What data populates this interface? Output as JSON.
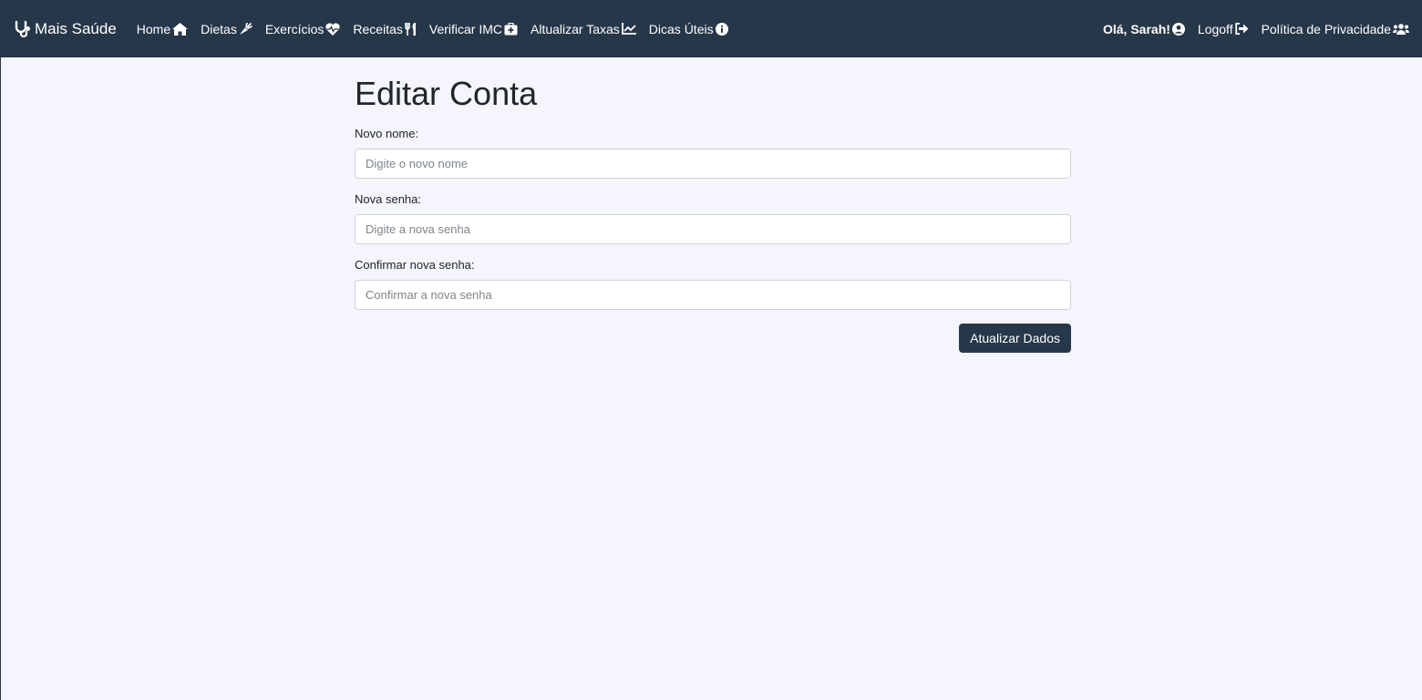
{
  "navbar": {
    "brand": "Mais Saúde",
    "left_items": [
      {
        "label": "Home",
        "icon": "home-icon"
      },
      {
        "label": "Dietas",
        "icon": "carrot-icon"
      },
      {
        "label": "Exercícios",
        "icon": "heartbeat-icon"
      },
      {
        "label": "Receitas",
        "icon": "utensils-icon"
      },
      {
        "label": "Verificar IMC",
        "icon": "medkit-icon"
      },
      {
        "label": "Altualizar Taxas",
        "icon": "chart-line-icon"
      },
      {
        "label": "Dicas Úteis",
        "icon": "info-circle-icon"
      }
    ],
    "right_items": [
      {
        "label": "Olá, Sarah!",
        "icon": "user-circle-icon"
      },
      {
        "label": "Logoff",
        "icon": "sign-out-icon"
      },
      {
        "label": "Política de Privacidade",
        "icon": "users-icon"
      }
    ]
  },
  "form": {
    "title": "Editar Conta",
    "fields": [
      {
        "label": "Novo nome:",
        "placeholder": "Digite o novo nome",
        "value": ""
      },
      {
        "label": "Nova senha:",
        "placeholder": "Digite a nova senha",
        "value": ""
      },
      {
        "label": "Confirmar nova senha:",
        "placeholder": "Confirmar a nova senha",
        "value": ""
      }
    ],
    "submit_label": "Atualizar Dados"
  },
  "colors": {
    "navbar_bg": "#27374a",
    "page_bg": "#f4f5fd",
    "button_bg": "#27374a"
  }
}
